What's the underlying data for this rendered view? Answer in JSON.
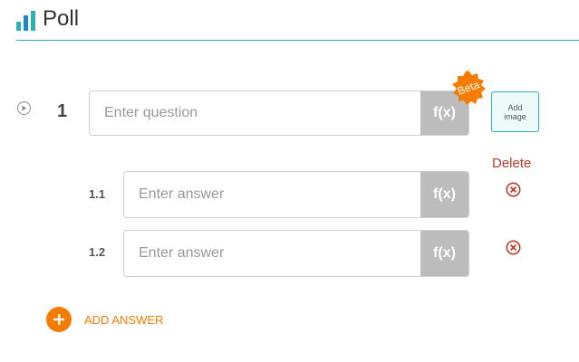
{
  "header": {
    "title": "Poll",
    "icon": "bar-chart-icon",
    "accent": "#2bb3b1"
  },
  "question": {
    "number": "1",
    "placeholder": "Enter question",
    "fx_label": "f(x)",
    "beta_label": "Beta",
    "add_image_label_line1": "Add",
    "add_image_label_line2": "image"
  },
  "answers_section": {
    "delete_label": "Delete"
  },
  "answers": [
    {
      "number": "1.1",
      "placeholder": "Enter answer",
      "fx_label": "f(x)"
    },
    {
      "number": "1.2",
      "placeholder": "Enter answer",
      "fx_label": "f(x)"
    }
  ],
  "add_answer": {
    "label": "ADD ANSWER"
  },
  "colors": {
    "orange": "#f57c00",
    "delete_red": "#c0392b",
    "fx_gray": "#bcbcbc"
  }
}
